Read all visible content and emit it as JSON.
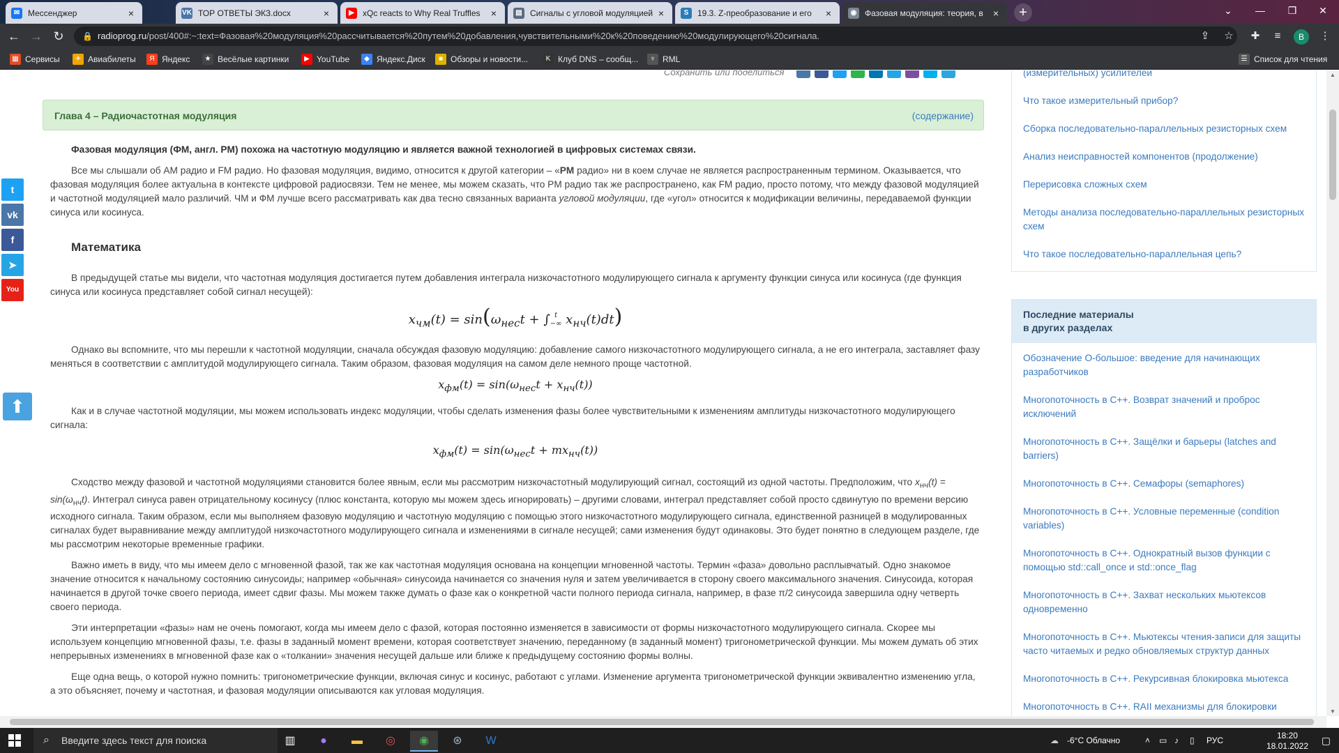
{
  "browser": {
    "tabs": [
      {
        "title": "Мессенджер",
        "icon": "messenger-icon",
        "color": "#1877f2",
        "glyph": "✉"
      },
      {
        "title": "ТОР ОТВЕТЫ ЭКЗ.docx",
        "icon": "vk-icon",
        "color": "#4a76a8",
        "glyph": "VK"
      },
      {
        "title": "xQc reacts to Why Real Truffles",
        "icon": "youtube-icon",
        "color": "#ff0000",
        "glyph": "▶"
      },
      {
        "title": "Сигналы с угловой модуляцией",
        "icon": "page-icon",
        "color": "#5a6b80",
        "glyph": "▤"
      },
      {
        "title": "19.3. Z-преобразование и его",
        "icon": "doc-icon",
        "color": "#2b7bb9",
        "glyph": "S"
      },
      {
        "title": "Фазовая модуляция: теория, в",
        "icon": "radioprog-icon",
        "color": "#7b8794",
        "glyph": "◉"
      }
    ],
    "url_host": "radioprog.ru",
    "url_rest": "/post/400#:~:text=Фазовая%20модуляция%20рассчитывается%20путем%20добавления,чувствительными%20к%20поведению%20модулирующего%20сигнала.",
    "profile_letter": "В",
    "bookmarks": [
      {
        "label": "Сервисы",
        "icon": "apps-icon",
        "color": "#e34c26",
        "glyph": "▦"
      },
      {
        "label": "Авиабилеты",
        "icon": "plane-icon",
        "color": "#f0a500",
        "glyph": "✈"
      },
      {
        "label": "Яндекс",
        "icon": "yandex-icon",
        "color": "#fc3f1d",
        "glyph": "Я"
      },
      {
        "label": "Весёлые картинки",
        "icon": "star-icon",
        "color": "#444",
        "glyph": "★"
      },
      {
        "label": "YouTube",
        "icon": "youtube-icon",
        "color": "#ff0000",
        "glyph": "▶"
      },
      {
        "label": "Яндекс.Диск",
        "icon": "disk-icon",
        "color": "#3b82f6",
        "glyph": "◆"
      },
      {
        "label": "Обзоры и новости...",
        "icon": "news-icon",
        "color": "#e0b000",
        "glyph": "■"
      },
      {
        "label": "Клуб DNS – сообщ...",
        "icon": "dns-icon",
        "color": "#333",
        "glyph": "K"
      },
      {
        "label": "RML",
        "icon": "rml-icon",
        "color": "#555",
        "glyph": "♆"
      }
    ],
    "reading_list": "Список для чтения"
  },
  "page": {
    "share_caption": "Сохранить или поделиться",
    "share_colors": [
      "#4a76a8",
      "#3b5998",
      "#1da1f2",
      "#2fb54a",
      "#0077b5",
      "#26a5e4",
      "#7b519d",
      "#00aff0",
      "#2ca5e0"
    ],
    "chapter": "Глава 4 – Радиочастотная модуляция",
    "toc_link": "(содержание)",
    "lead": "Фазовая модуляция (ФМ, англ. PM) похожа на частотную модуляцию и является важной технологией в цифровых системах связи.",
    "p1_a": "Все мы слышали об AM радио и FM радио. Но фазовая модуляция, видимо, относится к другой категории – «",
    "p1_b": "PM",
    "p1_c": " радио» ни в коем случае не является распространенным термином. Оказывается, что фазовая модуляция более актуальна в контексте цифровой радиосвязи. Тем не менее, мы можем сказать, что PM радио так же распространено, как FM радио, просто потому, что между фазовой модуляцией и частотной модуляцией мало различий. ЧМ и ФМ лучше всего рассматривать как два тесно связанных варианта ",
    "p1_d": "угловой модуляции",
    "p1_e": ", где «угол» относится к модификации величины, передаваемой функции синуса или косинуса.",
    "heading_math": "Математика",
    "p2": "В предыдущей статье мы видели, что частотная модуляция достигается путем добавления интеграла низкочастотного модулирующего сигнала к аргументу функции синуса или косинуса (где функция синуса или косинуса представляет собой сигнал несущей):",
    "f1_lhs": "x",
    "f1_sub": "чм",
    "f1_mid": "(t) = sin",
    "f1_body": "ω",
    "f1_body_sub": "нес",
    "f1_body_rest": "t + ∫",
    "f1_lim_hi": "t",
    "f1_lim_lo": "−∞",
    "f1_integrand": " x",
    "f1_integrand_sub": "нч",
    "f1_integrand_rest": "(t)dt",
    "p3": "Однако вы вспомните, что мы перешли к частотной модуляции, сначала обсуждая фазовую модуляцию: добавление самого низкочастотного модулирующего сигнала, а не его интеграла, заставляет фазу меняться в соответствии с амплитудой модулирующего сигнала. Таким образом, фазовая модуляция на самом деле немного проще частотной.",
    "f2_x": "x",
    "f2_sub": "фм",
    "f2_a": "(t) = sin(ω",
    "f2_nes": "нес",
    "f2_b": "t + x",
    "f2_nch": "нч",
    "f2_c": "(t))",
    "p4": "Как и в случае частотной модуляции, мы можем использовать индекс модуляции, чтобы сделать изменения фазы более чувствительными к изменениям амплитуды низкочастотного модулирующего сигнала:",
    "f3_x": "x",
    "f3_sub": "фм",
    "f3_a": "(t) = sin(ω",
    "f3_nes": "нес",
    "f3_b": "t + mx",
    "f3_nch": "нч",
    "f3_c": "(t))",
    "p5_a": "Сходство между фазовой и частотной модуляциями становится более явным, если мы рассмотрим низкочастотный модулирующий сигнал, состоящий из одной частоты. Предположим, что ",
    "p5_b": "x",
    "p5_b_sub": "нч",
    "p5_c": "(t) = sin(ω",
    "p5_c_sub": "нч",
    "p5_d": "t)",
    "p5_e": ". Интеграл синуса равен отрицательному косинусу (плюс константа, которую мы можем здесь игнорировать) – другими словами, интеграл представляет собой просто сдвинутую по времени версию исходного сигнала. Таким образом, если мы выполняем фазовую модуляцию и частотную модуляцию с помощью этого низкочастотного модулирующего сигнала, единственной разницей в модулированных сигналах будет выравнивание между амплитудой низкочастотного модулирующего сигнала и изменениями в сигнале несущей; сами изменения будут одинаковы. Это будет понятно в следующем разделе, где мы рассмотрим некоторые временные графики.",
    "p6": "Важно иметь в виду, что мы имеем дело с мгновенной фазой, так же как частотная модуляция основана на концепции мгновенной частоты. Термин «фаза» довольно расплывчатый. Одно знакомое значение относится к начальному состоянию синусоиды; например «обычная» синусоида начинается со значения нуля и затем увеличивается в сторону своего максимального значения. Синусоида, которая начинается в другой точке своего периода, имеет сдвиг фазы. Мы можем также думать о фазе как о конкретной части полного периода сигнала, например, в фазе π/2 синусоида завершила одну четверть своего периода.",
    "p7": "Эти интерпретации «фазы» нам не очень помогают, когда мы имеем дело с фазой, которая постоянно изменяется в зависимости от формы низкочастотного модулирующего сигнала. Скорее мы используем концепцию мгновенной фазы, т.е. фазы в заданный момент времени, которая соответствует значению, переданному (в заданный момент) тригонометрической функции. Мы можем думать об этих непрерывных изменениях в мгновенной фазе как о «толкании» значения несущей дальше или ближе к предыдущему состоянию формы волны.",
    "p8": "Еще одна вещь, о которой нужно помнить: тригонометрические функции, включая синус и косинус, работают с углами. Изменение аргумента тригонометрической функции эквивалентно изменению угла, а это объясняет, почему и частотная, и фазовая модуляции описываются как угловая модуляция."
  },
  "sidebar": {
    "top_links": [
      "(измерительных) усилителей",
      "Что такое измерительный прибор?",
      "Сборка последовательно-параллельных резисторных схем",
      "Анализ неисправностей компонентов (продолжение)",
      "Перерисовка сложных схем",
      "Методы анализа последовательно-параллельных резисторных схем",
      "Что такое последовательно-параллельная цепь?"
    ],
    "recent_title_1": "Последние материалы",
    "recent_title_2": "в других разделах",
    "recent_links": [
      "Обозначение O-большое: введение для начинающих разработчиков",
      "Многопоточность в C++. Возврат значений и проброс исключений",
      "Многопоточность в C++. Защёлки и барьеры (latches and barriers)",
      "Многопоточность в C++. Семафоры (semaphores)",
      "Многопоточность в C++. Условные переменные (condition variables)",
      "Многопоточность в C++. Однократный вызов функции с помощью std::call_once и std::once_flag",
      "Многопоточность в C++. Захват нескольких мьютексов одновременно",
      "Многопоточность в C++. Мьютексы чтения-записи для защиты часто читаемых и редко обновляемых структур данных",
      "Многопоточность в C++. Рекурсивная блокировка мьютекса",
      "Многопоточность в C++. RAII механизмы для блокировки"
    ]
  },
  "taskbar": {
    "search_placeholder": "Введите здесь текст для поиска",
    "weather": "-6°C Облачно",
    "lang": "РУС",
    "time": "18:20",
    "date": "18.01.2022"
  }
}
